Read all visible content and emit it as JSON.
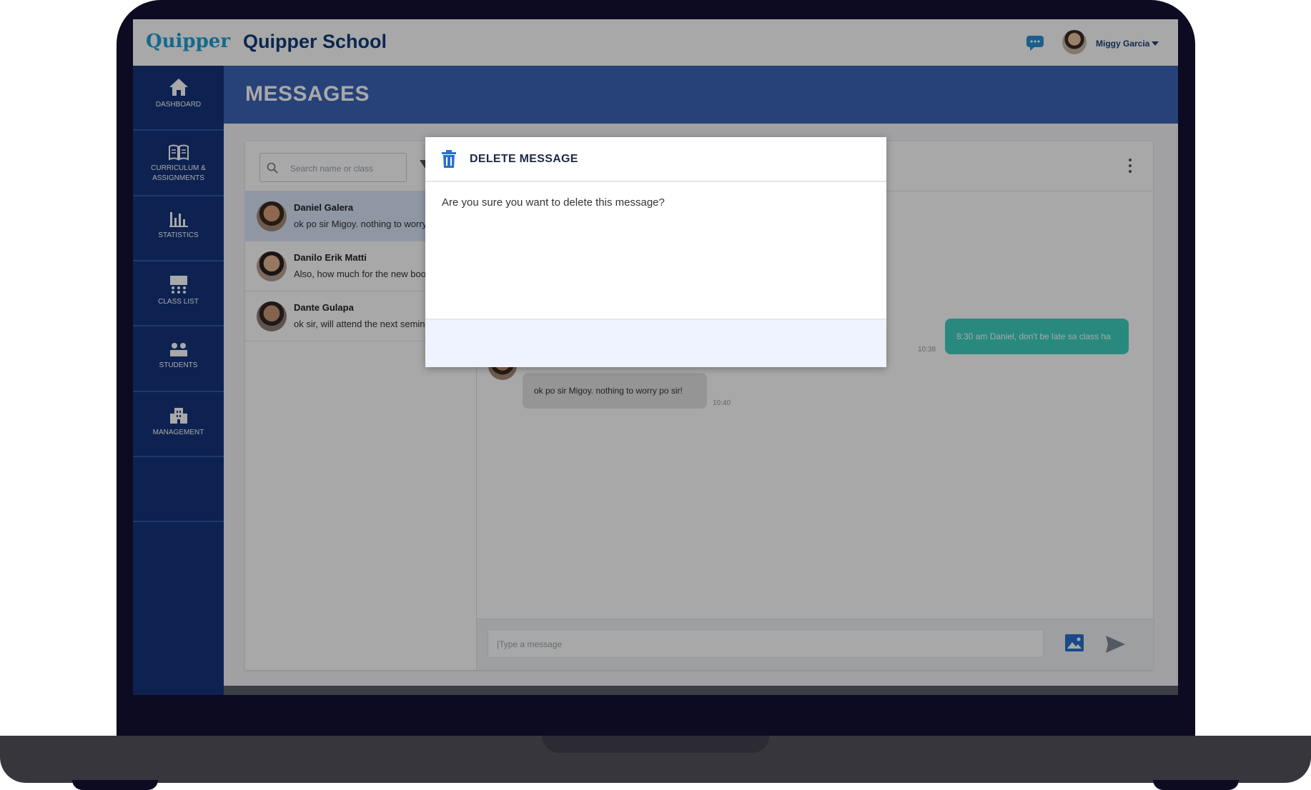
{
  "app": {
    "logo_text": "Quipper",
    "title": "Quipper School",
    "user_name": "Miggy Garcia"
  },
  "sidebar": {
    "items": [
      {
        "label": "DASHBOARD"
      },
      {
        "label": "CURRICULUM & ASSIGNMENTS"
      },
      {
        "label": "STATISTICS"
      },
      {
        "label": "CLASS LIST"
      },
      {
        "label": "STUDENTS"
      },
      {
        "label": "MANAGEMENT"
      }
    ]
  },
  "page": {
    "title": "MESSAGES"
  },
  "search": {
    "placeholder": "Search name or class"
  },
  "conversations": [
    {
      "name": "Daniel Galera",
      "preview": "ok po sir Migoy. nothing to worry po sir!",
      "active": true
    },
    {
      "name": "Danilo Erik Matti",
      "preview": "Also, how much for the new books?",
      "active": false
    },
    {
      "name": "Dante Gulapa",
      "preview": "ok sir, will attend the next seminar",
      "active": false
    }
  ],
  "chat": {
    "messages": [
      {
        "direction": "out",
        "text": "8:30 am Daniel, don't be late sa class ha",
        "time": "10:38"
      },
      {
        "direction": "in",
        "text": "ok po sir Migoy. nothing to worry po sir!",
        "time": "10:40"
      }
    ],
    "composer_placeholder": "|Type a message"
  },
  "modal": {
    "title": "DELETE MESSAGE",
    "body": "Are you sure you want to delete this message?"
  },
  "colors": {
    "brand_blue": "#14357c",
    "header_blue": "#3b64b6",
    "accent_teal": "#3fd1bf",
    "logo_blue": "#1ea0d8"
  },
  "icons": {
    "sidebar": [
      "home-icon",
      "book-icon",
      "bar-chart-icon",
      "classroom-icon",
      "students-icon",
      "building-icon"
    ],
    "topbar": [
      "chat-bubble-icon",
      "chevron-down-icon"
    ]
  }
}
